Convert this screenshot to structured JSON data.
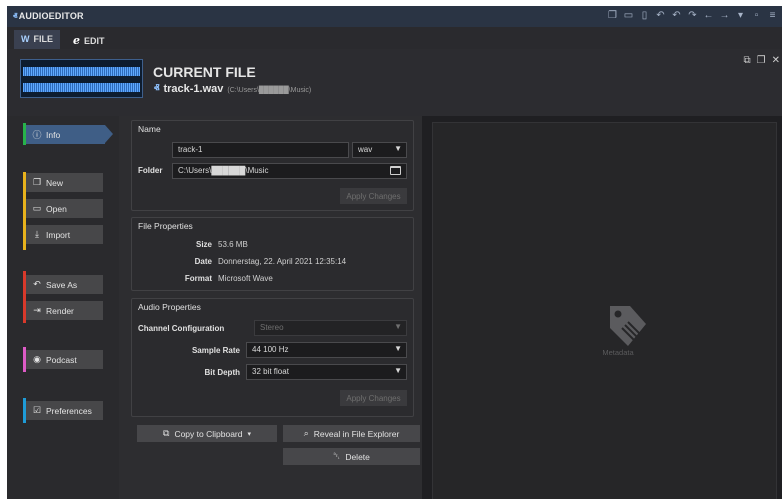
{
  "app": {
    "title": "AUDIOEDITOR"
  },
  "tabs": [
    {
      "label": "FILE"
    },
    {
      "label": "EDIT"
    }
  ],
  "header": {
    "title": "CURRENT FILE",
    "file_name": "track-1.wav",
    "file_path": "(C:\\Users\\██████\\Music)"
  },
  "nav": {
    "info": "Info",
    "new": "New",
    "open": "Open",
    "import": "Import",
    "save_as": "Save As",
    "render": "Render",
    "podcast": "Podcast",
    "preferences": "Preferences",
    "colors": {
      "info": "#27b34a",
      "file": "#e8b21c",
      "save": "#d8392b",
      "podcast": "#dd5bc6",
      "prefs": "#1e9bd7",
      "accent": "#3f5e86"
    }
  },
  "name_section": {
    "label": "Name",
    "name_value": "track-1",
    "format_value": "wav",
    "folder_label": "Folder",
    "folder_value": "C:\\Users\\██████\\Music",
    "apply_label": "Apply Changes"
  },
  "file_properties": {
    "label": "File Properties",
    "size_label": "Size",
    "size_value": "53.6 MB",
    "date_label": "Date",
    "date_value": "Donnerstag, 22. April 2021 12:35:14",
    "format_label": "Format",
    "format_value": "Microsoft Wave"
  },
  "audio_properties": {
    "label": "Audio Properties",
    "channel_label": "Channel Configuration",
    "channel_value": "Stereo",
    "sample_rate_label": "Sample Rate",
    "sample_rate_value": "44 100 Hz",
    "bit_depth_label": "Bit Depth",
    "bit_depth_value": "32 bit float",
    "apply_label": "Apply Changes"
  },
  "actions": {
    "copy_label": "Copy to Clipboard",
    "reveal_label": "Reveal in File Explorer",
    "delete_label": "Delete"
  },
  "metadata": {
    "label": "Metadata"
  }
}
